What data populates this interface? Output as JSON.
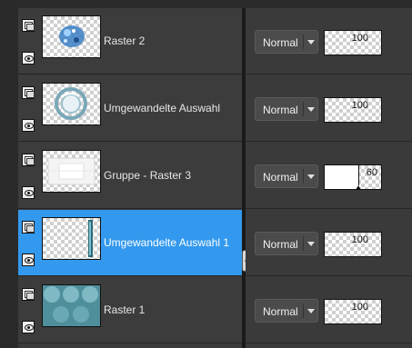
{
  "layers": [
    {
      "name": "Raster 2",
      "blend_mode": "Normal",
      "opacity": 100,
      "selected": false,
      "thumb_icon": "blue-glitter-thumbnail"
    },
    {
      "name": "Umgewandelte Auswahl",
      "blend_mode": "Normal",
      "opacity": 100,
      "selected": false,
      "thumb_icon": "glass-ring-thumbnail"
    },
    {
      "name": "Gruppe - Raster 3",
      "blend_mode": "Normal",
      "opacity": 60,
      "selected": false,
      "thumb_icon": "white-frame-thumbnail"
    },
    {
      "name": "Umgewandelte Auswahl 1",
      "blend_mode": "Normal",
      "opacity": 100,
      "selected": true,
      "thumb_icon": "vertical-bar-thumbnail"
    },
    {
      "name": "Raster 1",
      "blend_mode": "Normal",
      "opacity": 100,
      "selected": false,
      "thumb_icon": "teal-pattern-thumbnail"
    }
  ],
  "colors": {
    "selected_row": "#3399ee",
    "panel_bg": "#3c3c3c"
  }
}
